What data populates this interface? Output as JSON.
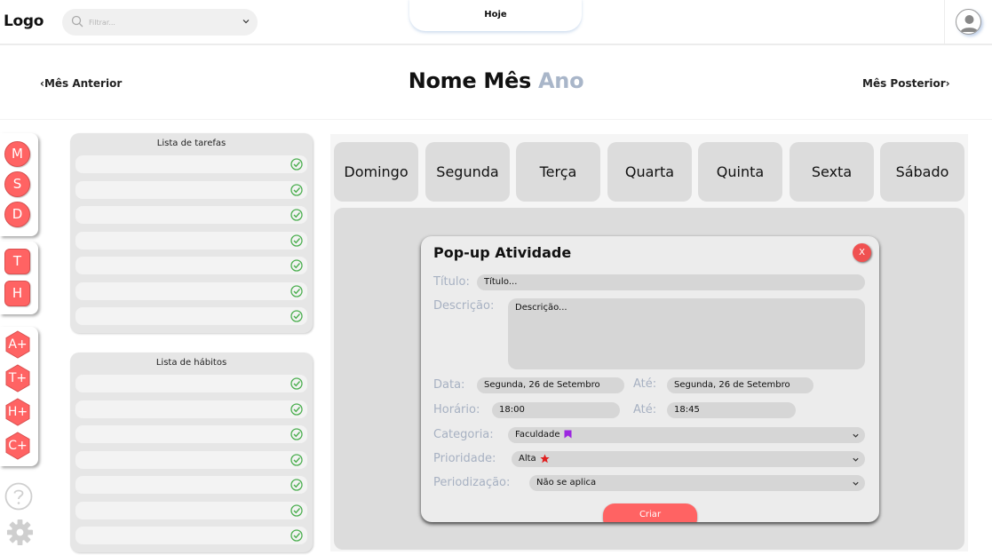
{
  "header": {
    "logo": "Logo",
    "search_placeholder": "Filtrar...",
    "today_label": "Hoje"
  },
  "month_nav": {
    "prev_label": "Mês Anterior",
    "month_name": "Nome Mês",
    "year": "Ano",
    "next_label": "Mês Posterior"
  },
  "sidebar": {
    "view_buttons": [
      "M",
      "S",
      "D"
    ],
    "list_buttons": [
      "T",
      "H"
    ],
    "add_buttons": [
      "A+",
      "T+",
      "H+",
      "C+"
    ]
  },
  "tasks": {
    "title": "Lista de tarefas",
    "items": [
      "",
      "",
      "",
      "",
      "",
      "",
      ""
    ]
  },
  "habits": {
    "title": "Lista de hábitos",
    "items": [
      "",
      "",
      "",
      "",
      "",
      "",
      ""
    ]
  },
  "calendar": {
    "weekdays": [
      "Domingo",
      "Segunda",
      "Terça",
      "Quarta",
      "Quinta",
      "Sexta",
      "Sábado"
    ]
  },
  "popup": {
    "title": "Pop-up Atividade",
    "close_label": "X",
    "titulo_label": "Título:",
    "titulo_value": "Título...",
    "descricao_label": "Descrição:",
    "descricao_value": "Descrição...",
    "data_label": "Data:",
    "data_value": "Segunda, 26 de Setembro",
    "data_ate_label": "Até:",
    "data_ate_value": "Segunda, 26 de Setembro",
    "horario_label": "Horário:",
    "horario_value": "18:00",
    "horario_ate_label": "Até:",
    "horario_ate_value": "18:45",
    "categoria_label": "Categoria:",
    "categoria_value": "Faculdade",
    "prioridade_label": "Prioridade:",
    "prioridade_value": "Alta",
    "periodizacao_label": "Periodização:",
    "periodizacao_value": "Não se aplica",
    "submit_label": "Criar"
  },
  "colors": {
    "accent": "#ff6363",
    "check": "#4caf50",
    "category_tag": "#9c27e0",
    "priority_star": "#e02020",
    "muted_label": "#a7b1c2"
  },
  "icons": {
    "search": "search-icon",
    "dropdown": "chevron-down-icon",
    "user": "user-avatar-icon",
    "check": "check-circle-icon",
    "help": "help-icon",
    "settings": "gear-icon",
    "category": "bookmark-icon",
    "priority": "star-icon"
  }
}
